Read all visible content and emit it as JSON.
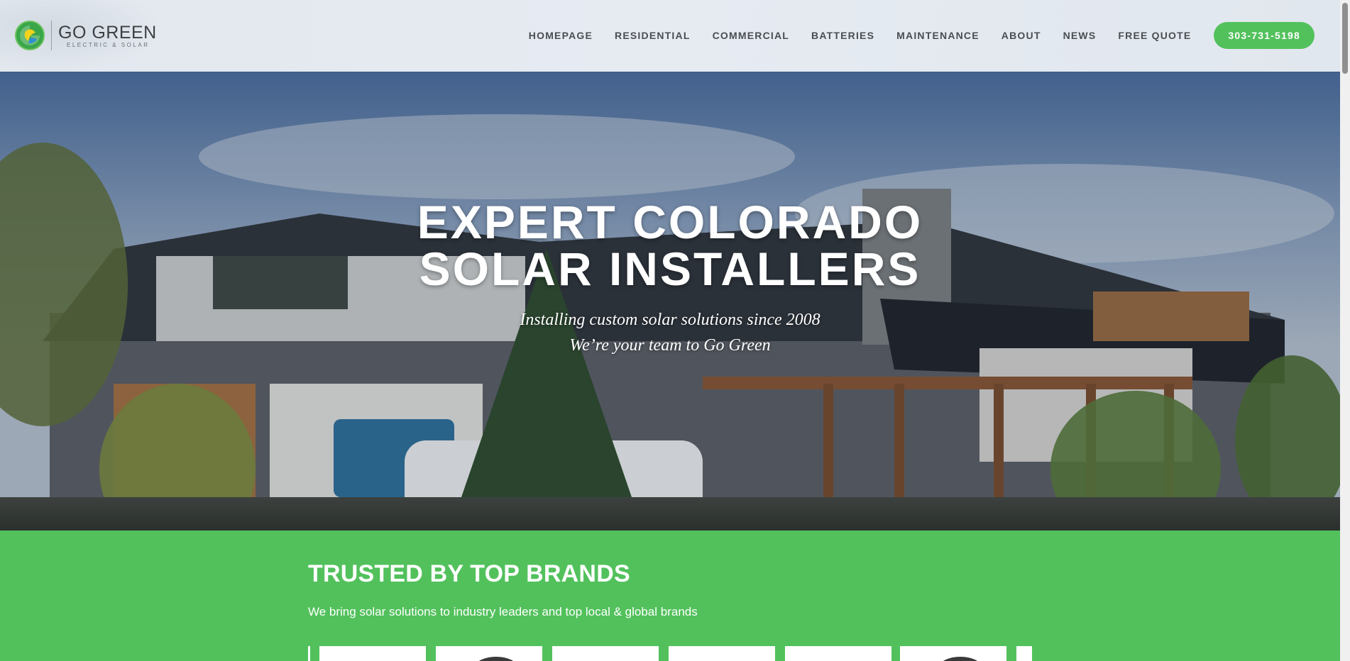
{
  "header": {
    "logo_name": "GO GREEN",
    "logo_sub": "ELECTRIC & SOLAR",
    "nav": [
      "HOMEPAGE",
      "RESIDENTIAL",
      "COMMERCIAL",
      "BATTERIES",
      "MAINTENANCE",
      "ABOUT",
      "NEWS",
      "FREE QUOTE"
    ],
    "phone": "303-731-5198"
  },
  "hero": {
    "title_line1": "EXPERT COLORADO",
    "title_line2": "SOLAR INSTALLERS",
    "subtitle_line1": "Installing custom solar solutions since 2008",
    "subtitle_line2": "We’re your team to Go Green"
  },
  "brands": {
    "title": "TRUSTED BY TOP BRANDS",
    "description": "We bring solar solutions to industry leaders and top local & global brands"
  },
  "colors": {
    "accent_green": "#52c15c",
    "header_bg": "#e3e8ef",
    "nav_text": "#4a4d52"
  },
  "icons": [
    "go-green-logo-icon"
  ]
}
